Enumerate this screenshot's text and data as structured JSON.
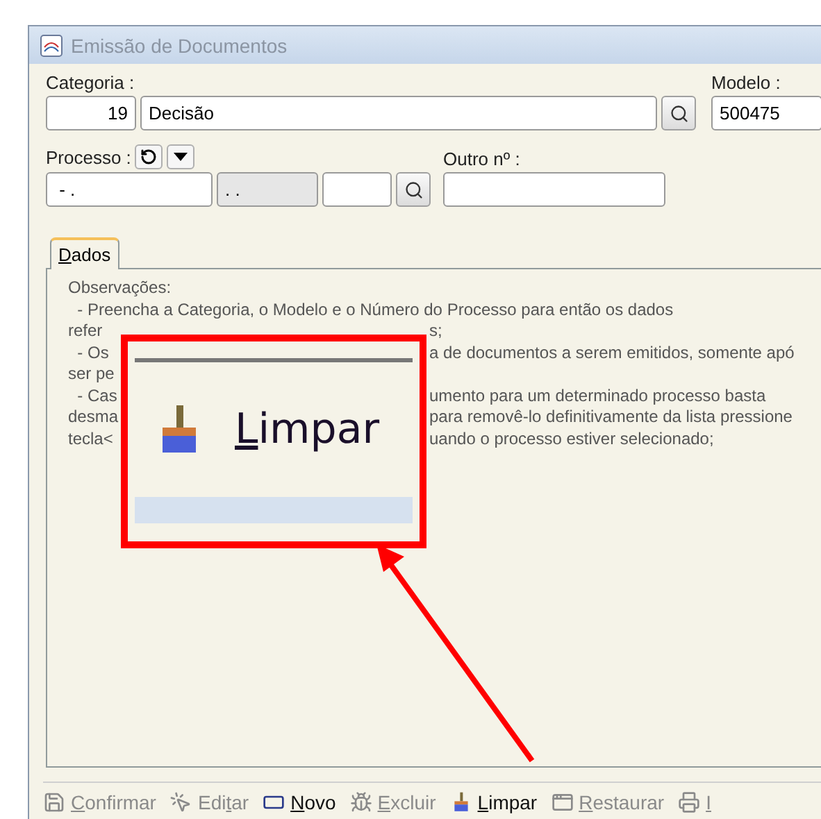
{
  "window": {
    "title": "Emissão de Documentos"
  },
  "categoria": {
    "label": "Categoria :",
    "code": "19",
    "description": "Decisão"
  },
  "modelo": {
    "label": "Modelo :",
    "value": "500475"
  },
  "processo": {
    "label": "Processo :",
    "part_1": " - .",
    "part_2": ". ."
  },
  "outro": {
    "label": "Outro nº :"
  },
  "tabs": [
    {
      "key": "D",
      "post": "ados",
      "selected": true
    }
  ],
  "observations": [
    {
      "kind": "full",
      "text": "Observações:"
    },
    {
      "kind": "full",
      "text": "  - Preencha a Categoria, o Modelo e o Número do Processo para então os dados"
    },
    {
      "kind": "split",
      "left": "refer",
      "right": "s;"
    },
    {
      "kind": "split",
      "left": "  - Os",
      "right": "a de documentos a serem emitidos, somente apó"
    },
    {
      "kind": "split",
      "left": "ser pe"
    },
    {
      "kind": "split",
      "left": "  - Cas",
      "right": "umento para um determinado processo basta"
    },
    {
      "kind": "split",
      "left": "desma",
      "right": "para removê-lo definitivamente da lista pressione"
    },
    {
      "kind": "split",
      "left": "tecla<",
      "right": "uando o processo estiver selecionado;"
    }
  ],
  "toolbar": [
    {
      "kind": "save",
      "key": "C",
      "post": "onfirmar",
      "disabled": true
    },
    {
      "kind": "edit",
      "pre": "Edi",
      "key": "t",
      "post": "ar",
      "disabled": true
    },
    {
      "kind": "new",
      "key": "N",
      "post": "ovo",
      "disabled": false
    },
    {
      "kind": "delete",
      "key": "E",
      "post": "xcluir",
      "disabled": true
    },
    {
      "kind": "clear",
      "key": "L",
      "post": "impar",
      "disabled": false
    },
    {
      "kind": "restore",
      "key": "R",
      "post": "estaurar",
      "disabled": true
    },
    {
      "kind": "print",
      "key": "I",
      "disabled": true
    }
  ],
  "callout": {
    "key": "L",
    "post": "impar"
  }
}
